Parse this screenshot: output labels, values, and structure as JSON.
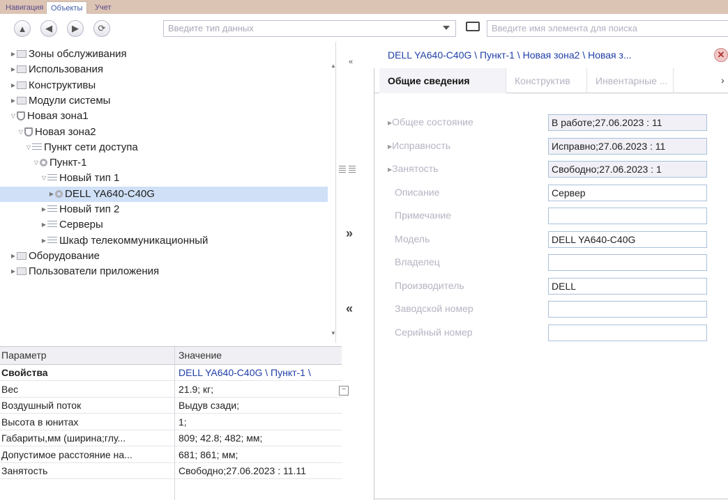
{
  "top_tabs": [
    "Навигация",
    "Объекты",
    "Учет"
  ],
  "toolbar": {
    "type_placeholder": "Введите тип данных",
    "search_placeholder": "Введите имя элемента для поиска"
  },
  "tree": [
    {
      "label": "Зоны обслуживания",
      "icon": "folder-icon",
      "level": 0,
      "expander": "collapsed"
    },
    {
      "label": "Использования",
      "icon": "folder-icon",
      "level": 0,
      "expander": "collapsed"
    },
    {
      "label": "Конструктивы",
      "icon": "folder-icon",
      "level": 0,
      "expander": "collapsed"
    },
    {
      "label": "Модули системы",
      "icon": "folder-icon",
      "level": 0,
      "expander": "collapsed"
    },
    {
      "label": "Новая зона1",
      "icon": "shield-icon",
      "level": 0,
      "expander": "expanded"
    },
    {
      "label": "Новая зона2",
      "icon": "shield-icon",
      "level": 1,
      "expander": "expanded"
    },
    {
      "label": "Пункт сети доступа",
      "icon": "list-icon",
      "level": 2,
      "expander": "expanded"
    },
    {
      "label": "Пункт-1",
      "icon": "node-icon",
      "level": 3,
      "expander": "expanded"
    },
    {
      "label": "Новый тип 1",
      "icon": "list-icon",
      "level": 4,
      "expander": "expanded"
    },
    {
      "label": "DELL YA640-C40G",
      "icon": "node-icon",
      "level": 5,
      "expander": "collapsed",
      "selected": true
    },
    {
      "label": "Новый тип 2",
      "icon": "list-icon",
      "level": 4,
      "expander": "collapsed"
    },
    {
      "label": "Серверы",
      "icon": "list-icon",
      "level": 4,
      "expander": "collapsed"
    },
    {
      "label": "Шкаф телекоммуникационный",
      "icon": "list-icon",
      "level": 4,
      "expander": "collapsed"
    },
    {
      "label": "Оборудование",
      "icon": "folder-icon",
      "level": 0,
      "expander": "collapsed"
    },
    {
      "label": "Пользователи приложения",
      "icon": "folder-icon",
      "level": 0,
      "expander": "collapsed"
    }
  ],
  "grid": {
    "headers": [
      "Параметр",
      "Значение"
    ],
    "rows": [
      {
        "param": "Свойства",
        "value": "DELL YA640-C40G \\ Пункт-1 \\",
        "bold": true
      },
      {
        "param": "Вес",
        "value": "21.9; кг;"
      },
      {
        "param": "Воздушный поток",
        "value": "Выдув сзади;"
      },
      {
        "param": "Высота в юнитах",
        "value": "1;"
      },
      {
        "param": "Габариты,мм (ширина;глу...",
        "value": "809; 42.8; 482; мм;"
      },
      {
        "param": "Допустимое расстояние на...",
        "value": "681; 861; мм;"
      },
      {
        "param": "Занятость",
        "value": "Свободно;27.06.2023 : 11.11"
      }
    ]
  },
  "detail": {
    "breadcrumb": "DELL YA640-C40G \\ Пункт-1 \\ Новая зона2 \\ Новая з...",
    "tabs": [
      "Общие сведения",
      "Конструктив",
      "Инвентарные ..."
    ],
    "fields": [
      {
        "label": "Общее состояние",
        "value": "В работе;27.06.2023 : 11",
        "readonly": true,
        "arrow": true
      },
      {
        "label": "Исправность",
        "value": "Исправно;27.06.2023 : 11",
        "readonly": true,
        "arrow": true
      },
      {
        "label": "Занятость",
        "value": "Свободно;27.06.2023 : 1",
        "readonly": true,
        "arrow": true
      },
      {
        "label": "Описание",
        "value": "Сервер"
      },
      {
        "label": "Примечание",
        "value": ""
      },
      {
        "label": "Модель",
        "value": "DELL YA640-C40G"
      },
      {
        "label": "Владелец",
        "value": ""
      },
      {
        "label": "Производитель",
        "value": "DELL"
      },
      {
        "label": "Заводской номер",
        "value": ""
      },
      {
        "label": "Серийный номер",
        "value": ""
      }
    ]
  },
  "colors": {
    "selection": "#cfe0f7",
    "link": "#1f3ea8",
    "muted_label": "#b4b4c4",
    "tab_bar": "#dcc4b4"
  }
}
